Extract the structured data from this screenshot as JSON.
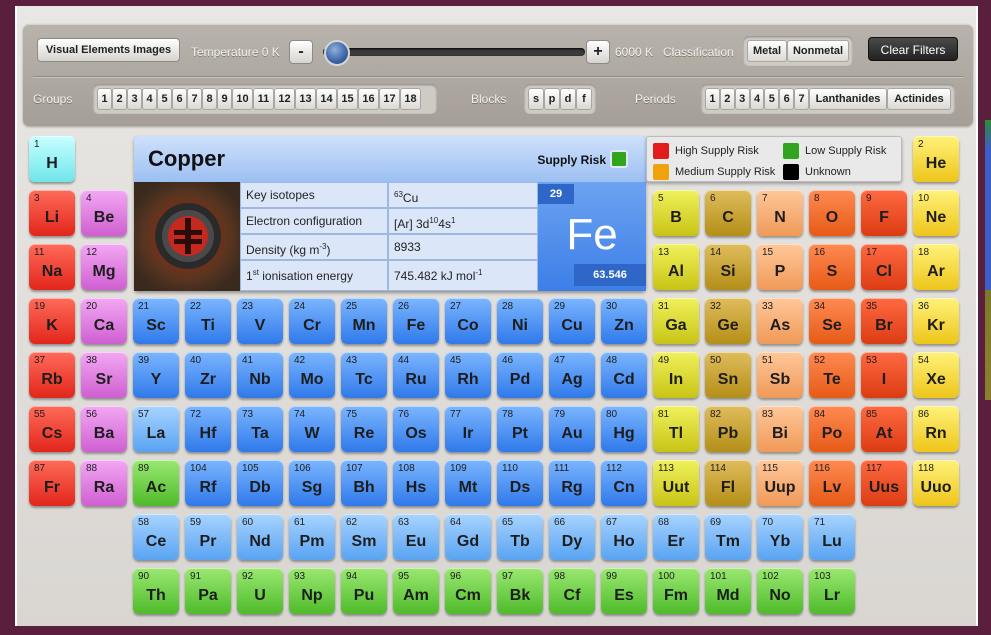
{
  "toolbar": {
    "images_label": "Visual Elements Images",
    "temperature_label": "Temperature 0 K",
    "minus": "-",
    "plus": "+",
    "temp_max": "6000 K",
    "classification_label": "Classification",
    "metal": "Metal",
    "nonmetal": "Nonmetal",
    "clear": "Clear Filters",
    "groups_label": "Groups",
    "groups": [
      "1",
      "2",
      "3",
      "4",
      "5",
      "6",
      "7",
      "8",
      "9",
      "10",
      "11",
      "12",
      "13",
      "14",
      "15",
      "16",
      "17",
      "18"
    ],
    "blocks_label": "Blocks",
    "blocks": [
      "s",
      "p",
      "d",
      "f"
    ],
    "periods_label": "Periods",
    "periods": [
      "1",
      "2",
      "3",
      "4",
      "5",
      "6",
      "7",
      "Lanthanides",
      "Actinides"
    ],
    "temperature_fraction": 0.0
  },
  "info": {
    "name": "Copper",
    "supply_risk_label": "Supply Risk",
    "supply_risk_color": "#2ea51d",
    "props": [
      {
        "key": "Key isotopes",
        "val": "63Cu"
      },
      {
        "key": "Electron configuration",
        "val": "[Ar] 3d104s1"
      },
      {
        "key": "Density (kg m-3)",
        "val": "8933"
      },
      {
        "key": "1st ionisation energy",
        "val": "745.482 kJ mol-1"
      }
    ],
    "tile_number": "29",
    "tile_symbol": "Fe",
    "tile_mass": "63.546"
  },
  "legend": [
    {
      "label": "High Supply Risk",
      "color": "#e21b1b"
    },
    {
      "label": "Low Supply Risk",
      "color": "#2ea51d"
    },
    {
      "label": "Medium Supply Risk",
      "color": "#f0a20c"
    },
    {
      "label": "Unknown",
      "color": "#000000"
    }
  ],
  "elements": [
    [
      "1",
      "H",
      0,
      0,
      "h"
    ],
    [
      "2",
      "He",
      17,
      0,
      "ng"
    ],
    [
      "3",
      "Li",
      0,
      1,
      "alk"
    ],
    [
      "4",
      "Be",
      1,
      1,
      "ae"
    ],
    [
      "5",
      "B",
      12,
      1,
      "pt"
    ],
    [
      "6",
      "C",
      13,
      1,
      "mt"
    ],
    [
      "7",
      "N",
      14,
      1,
      "nm"
    ],
    [
      "8",
      "O",
      15,
      1,
      "hal"
    ],
    [
      "9",
      "F",
      16,
      1,
      "hal2"
    ],
    [
      "10",
      "Ne",
      17,
      1,
      "ng"
    ],
    [
      "11",
      "Na",
      0,
      2,
      "alk"
    ],
    [
      "12",
      "Mg",
      1,
      2,
      "ae"
    ],
    [
      "13",
      "Al",
      12,
      2,
      "pt"
    ],
    [
      "14",
      "Si",
      13,
      2,
      "mt"
    ],
    [
      "15",
      "P",
      14,
      2,
      "nm"
    ],
    [
      "16",
      "S",
      15,
      2,
      "hal"
    ],
    [
      "17",
      "Cl",
      16,
      2,
      "hal2"
    ],
    [
      "18",
      "Ar",
      17,
      2,
      "ng"
    ],
    [
      "19",
      "K",
      0,
      3,
      "alk"
    ],
    [
      "20",
      "Ca",
      1,
      3,
      "ae"
    ],
    [
      "21",
      "Sc",
      2,
      3,
      "tm"
    ],
    [
      "22",
      "Ti",
      3,
      3,
      "tm"
    ],
    [
      "23",
      "V",
      4,
      3,
      "tm"
    ],
    [
      "24",
      "Cr",
      5,
      3,
      "tm"
    ],
    [
      "25",
      "Mn",
      6,
      3,
      "tm"
    ],
    [
      "26",
      "Fe",
      7,
      3,
      "tm"
    ],
    [
      "27",
      "Co",
      8,
      3,
      "tm"
    ],
    [
      "28",
      "Ni",
      9,
      3,
      "tm"
    ],
    [
      "29",
      "Cu",
      10,
      3,
      "tm"
    ],
    [
      "30",
      "Zn",
      11,
      3,
      "tm"
    ],
    [
      "31",
      "Ga",
      12,
      3,
      "pt"
    ],
    [
      "32",
      "Ge",
      13,
      3,
      "mt"
    ],
    [
      "33",
      "As",
      14,
      3,
      "nm"
    ],
    [
      "34",
      "Se",
      15,
      3,
      "hal"
    ],
    [
      "35",
      "Br",
      16,
      3,
      "hal2"
    ],
    [
      "36",
      "Kr",
      17,
      3,
      "ng"
    ],
    [
      "37",
      "Rb",
      0,
      4,
      "alk"
    ],
    [
      "38",
      "Sr",
      1,
      4,
      "ae"
    ],
    [
      "39",
      "Y",
      2,
      4,
      "tm"
    ],
    [
      "40",
      "Zr",
      3,
      4,
      "tm"
    ],
    [
      "41",
      "Nb",
      4,
      4,
      "tm"
    ],
    [
      "42",
      "Mo",
      5,
      4,
      "tm"
    ],
    [
      "43",
      "Tc",
      6,
      4,
      "tm"
    ],
    [
      "44",
      "Ru",
      7,
      4,
      "tm"
    ],
    [
      "45",
      "Rh",
      8,
      4,
      "tm"
    ],
    [
      "46",
      "Pd",
      9,
      4,
      "tm"
    ],
    [
      "47",
      "Ag",
      10,
      4,
      "tm"
    ],
    [
      "48",
      "Cd",
      11,
      4,
      "tm"
    ],
    [
      "49",
      "In",
      12,
      4,
      "pt"
    ],
    [
      "50",
      "Sn",
      13,
      4,
      "mt"
    ],
    [
      "51",
      "Sb",
      14,
      4,
      "nm"
    ],
    [
      "52",
      "Te",
      15,
      4,
      "hal"
    ],
    [
      "53",
      "I",
      16,
      4,
      "hal2"
    ],
    [
      "54",
      "Xe",
      17,
      4,
      "ng"
    ],
    [
      "55",
      "Cs",
      0,
      5,
      "alk"
    ],
    [
      "56",
      "Ba",
      1,
      5,
      "ae"
    ],
    [
      "57",
      "La",
      2,
      5,
      "ln"
    ],
    [
      "72",
      "Hf",
      3,
      5,
      "tm"
    ],
    [
      "73",
      "Ta",
      4,
      5,
      "tm"
    ],
    [
      "74",
      "W",
      5,
      5,
      "tm"
    ],
    [
      "75",
      "Re",
      6,
      5,
      "tm"
    ],
    [
      "76",
      "Os",
      7,
      5,
      "tm"
    ],
    [
      "77",
      "Ir",
      8,
      5,
      "tm"
    ],
    [
      "78",
      "Pt",
      9,
      5,
      "tm"
    ],
    [
      "79",
      "Au",
      10,
      5,
      "tm"
    ],
    [
      "80",
      "Hg",
      11,
      5,
      "tm"
    ],
    [
      "81",
      "Tl",
      12,
      5,
      "pt"
    ],
    [
      "82",
      "Pb",
      13,
      5,
      "mt"
    ],
    [
      "83",
      "Bi",
      14,
      5,
      "nm"
    ],
    [
      "84",
      "Po",
      15,
      5,
      "hal"
    ],
    [
      "85",
      "At",
      16,
      5,
      "hal2"
    ],
    [
      "86",
      "Rn",
      17,
      5,
      "ng"
    ],
    [
      "87",
      "Fr",
      0,
      6,
      "alk"
    ],
    [
      "88",
      "Ra",
      1,
      6,
      "ae"
    ],
    [
      "89",
      "Ac",
      2,
      6,
      "ac"
    ],
    [
      "104",
      "Rf",
      3,
      6,
      "tm"
    ],
    [
      "105",
      "Db",
      4,
      6,
      "tm"
    ],
    [
      "106",
      "Sg",
      5,
      6,
      "tm"
    ],
    [
      "107",
      "Bh",
      6,
      6,
      "tm"
    ],
    [
      "108",
      "Hs",
      7,
      6,
      "tm"
    ],
    [
      "109",
      "Mt",
      8,
      6,
      "tm"
    ],
    [
      "110",
      "Ds",
      9,
      6,
      "tm"
    ],
    [
      "111",
      "Rg",
      10,
      6,
      "tm"
    ],
    [
      "112",
      "Cn",
      11,
      6,
      "tm"
    ],
    [
      "113",
      "Uut",
      12,
      6,
      "pt"
    ],
    [
      "114",
      "Fl",
      13,
      6,
      "mt"
    ],
    [
      "115",
      "Uup",
      14,
      6,
      "nm"
    ],
    [
      "116",
      "Lv",
      15,
      6,
      "hal"
    ],
    [
      "117",
      "Uus",
      16,
      6,
      "hal2"
    ],
    [
      "118",
      "Uuo",
      17,
      6,
      "ng"
    ],
    [
      "58",
      "Ce",
      2,
      7,
      "ln"
    ],
    [
      "59",
      "Pr",
      3,
      7,
      "ln"
    ],
    [
      "60",
      "Nd",
      4,
      7,
      "ln"
    ],
    [
      "61",
      "Pm",
      5,
      7,
      "ln"
    ],
    [
      "62",
      "Sm",
      6,
      7,
      "ln"
    ],
    [
      "63",
      "Eu",
      7,
      7,
      "ln"
    ],
    [
      "64",
      "Gd",
      8,
      7,
      "ln"
    ],
    [
      "65",
      "Tb",
      9,
      7,
      "ln"
    ],
    [
      "66",
      "Dy",
      10,
      7,
      "ln"
    ],
    [
      "67",
      "Ho",
      11,
      7,
      "ln"
    ],
    [
      "68",
      "Er",
      12,
      7,
      "ln"
    ],
    [
      "69",
      "Tm",
      13,
      7,
      "ln"
    ],
    [
      "70",
      "Yb",
      14,
      7,
      "ln"
    ],
    [
      "71",
      "Lu",
      15,
      7,
      "ln"
    ],
    [
      "90",
      "Th",
      2,
      8,
      "ac"
    ],
    [
      "91",
      "Pa",
      3,
      8,
      "ac"
    ],
    [
      "92",
      "U",
      4,
      8,
      "ac"
    ],
    [
      "93",
      "Np",
      5,
      8,
      "ac"
    ],
    [
      "94",
      "Pu",
      6,
      8,
      "ac"
    ],
    [
      "95",
      "Am",
      7,
      8,
      "ac"
    ],
    [
      "96",
      "Cm",
      8,
      8,
      "ac"
    ],
    [
      "97",
      "Bk",
      9,
      8,
      "ac"
    ],
    [
      "98",
      "Cf",
      10,
      8,
      "ac"
    ],
    [
      "99",
      "Es",
      11,
      8,
      "ac"
    ],
    [
      "100",
      "Fm",
      12,
      8,
      "ac"
    ],
    [
      "101",
      "Md",
      13,
      8,
      "ac"
    ],
    [
      "102",
      "No",
      14,
      8,
      "ac"
    ],
    [
      "103",
      "Lr",
      15,
      8,
      "ac"
    ]
  ]
}
